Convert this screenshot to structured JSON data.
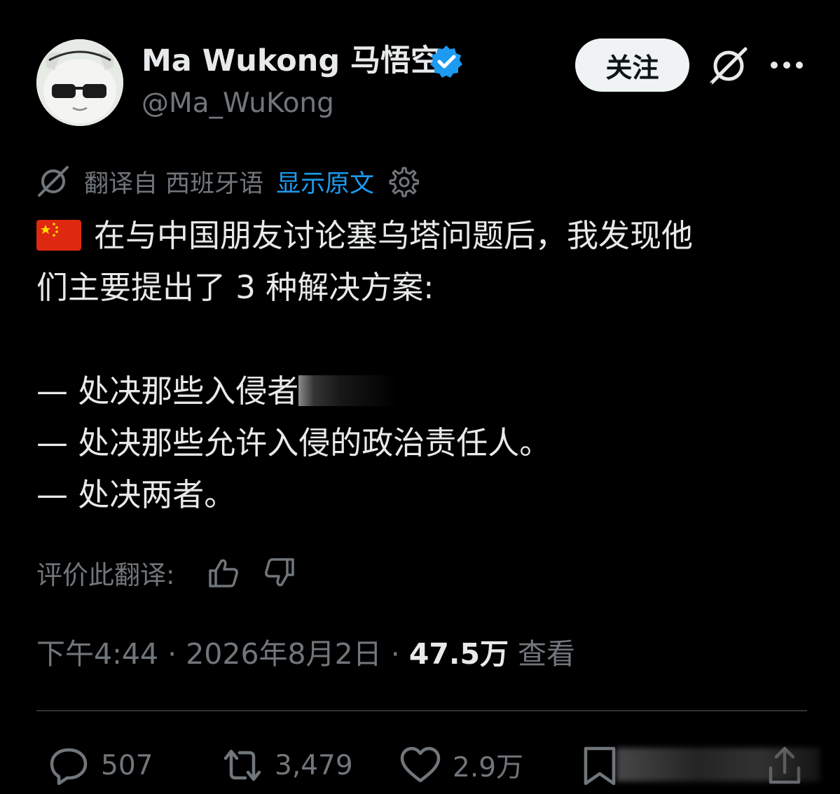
{
  "user": {
    "display_name": "Ma Wukong 马悟空",
    "handle": "@Ma_WuKong",
    "verified": true,
    "verified_color": "#1d9bf0",
    "avatar_icon": "cartoon-cat-with-sunglasses"
  },
  "header": {
    "follow_label": "关注",
    "grok_icon": "grok-icon",
    "more_icon": "more-icon"
  },
  "translation": {
    "translated_from": "翻译自 西班牙语",
    "show_original": "显示原文",
    "settings_icon": "gear-icon"
  },
  "tweet": {
    "flag_icon": "china-flag",
    "lines": [
      "在与中国朋友讨论塞乌塔问题后，我发现他",
      "们主要提出了 3 种解决方案:",
      "— 处决那些入侵者",
      "— 处决那些允许入侵的政治责任人。",
      "— 处决两者。"
    ]
  },
  "rating": {
    "label": "评价此翻译:",
    "thumb_up_icon": "thumb-up-icon",
    "thumb_down_icon": "thumb-down-icon"
  },
  "meta": {
    "time": "下午4:44",
    "separator": " · ",
    "date": "2026年8月2日",
    "views_count": "47.5万",
    "views_label": " 查看"
  },
  "actions": {
    "reply_count": "507",
    "retweet_count": "3,479",
    "like_count": "2.9万"
  },
  "colors": {
    "background": "#000000",
    "text_primary": "#e7e9ea",
    "text_secondary": "#71767b",
    "link": "#1d9bf0",
    "divider": "#2f3336"
  }
}
